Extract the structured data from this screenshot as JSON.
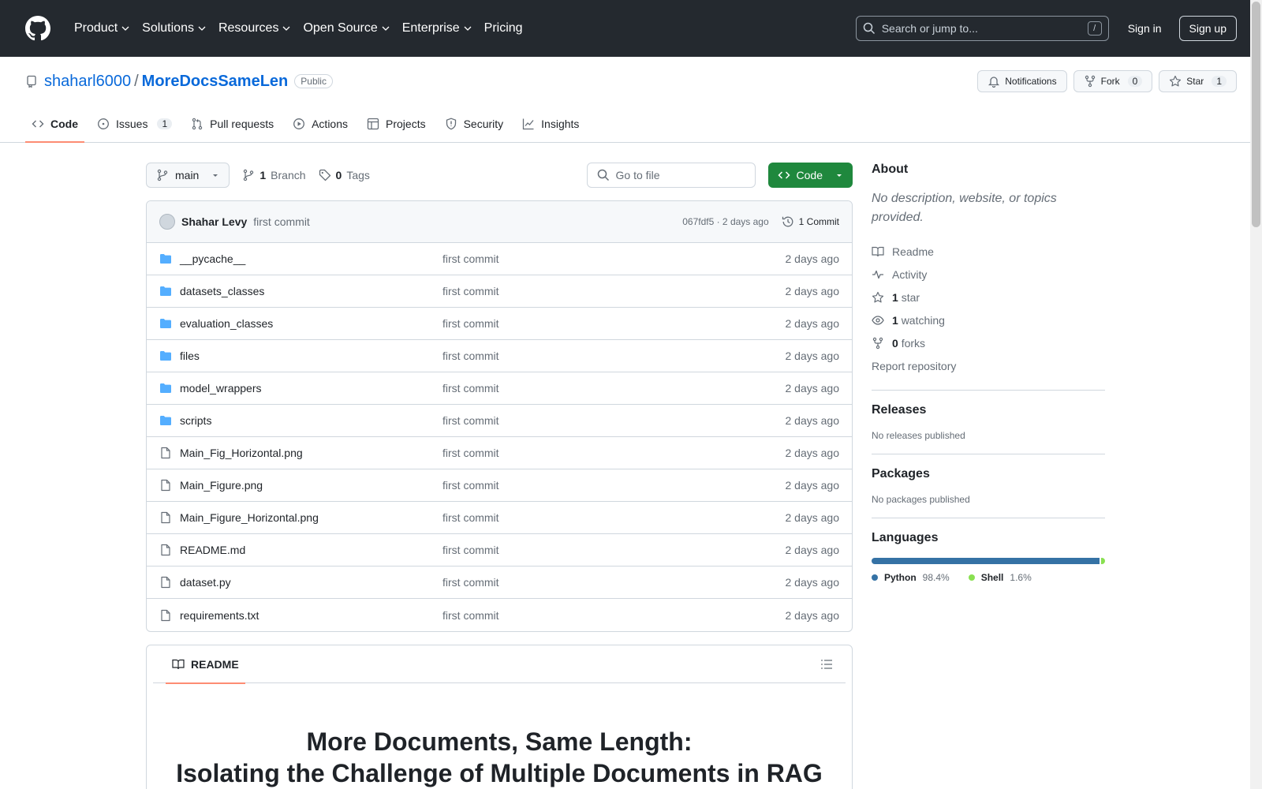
{
  "header": {
    "nav": [
      "Product",
      "Solutions",
      "Resources",
      "Open Source",
      "Enterprise",
      "Pricing"
    ],
    "search_placeholder": "Search or jump to...",
    "search_kbd": "/",
    "signin": "Sign in",
    "signup": "Sign up"
  },
  "repo": {
    "owner": "shaharl6000",
    "name": "MoreDocsSameLen",
    "visibility": "Public",
    "notifications_label": "Notifications",
    "fork_label": "Fork",
    "fork_count": "0",
    "star_label": "Star",
    "star_count": "1"
  },
  "tabs": [
    {
      "label": "Code"
    },
    {
      "label": "Issues",
      "count": "1"
    },
    {
      "label": "Pull requests"
    },
    {
      "label": "Actions"
    },
    {
      "label": "Projects"
    },
    {
      "label": "Security"
    },
    {
      "label": "Insights"
    }
  ],
  "toolbar": {
    "branch": "main",
    "branch_count": "1",
    "branch_label": "Branch",
    "tag_count": "0",
    "tag_label": "Tags",
    "gofile_placeholder": "Go to file",
    "code_button": "Code"
  },
  "commit": {
    "author": "Shahar Levy",
    "message": "first commit",
    "hash_time": "067fdf5 · 2 days ago",
    "count_label": "1 Commit"
  },
  "files": [
    {
      "name": "__pycache__",
      "type": "dir",
      "message": "first commit",
      "date": "2 days ago"
    },
    {
      "name": "datasets_classes",
      "type": "dir",
      "message": "first commit",
      "date": "2 days ago"
    },
    {
      "name": "evaluation_classes",
      "type": "dir",
      "message": "first commit",
      "date": "2 days ago"
    },
    {
      "name": "files",
      "type": "dir",
      "message": "first commit",
      "date": "2 days ago"
    },
    {
      "name": "model_wrappers",
      "type": "dir",
      "message": "first commit",
      "date": "2 days ago"
    },
    {
      "name": "scripts",
      "type": "dir",
      "message": "first commit",
      "date": "2 days ago"
    },
    {
      "name": "Main_Fig_Horizontal.png",
      "type": "file",
      "message": "first commit",
      "date": "2 days ago"
    },
    {
      "name": "Main_Figure.png",
      "type": "file",
      "message": "first commit",
      "date": "2 days ago"
    },
    {
      "name": "Main_Figure_Horizontal.png",
      "type": "file",
      "message": "first commit",
      "date": "2 days ago"
    },
    {
      "name": "README.md",
      "type": "file",
      "message": "first commit",
      "date": "2 days ago"
    },
    {
      "name": "dataset.py",
      "type": "file",
      "message": "first commit",
      "date": "2 days ago"
    },
    {
      "name": "requirements.txt",
      "type": "file",
      "message": "first commit",
      "date": "2 days ago"
    }
  ],
  "readme": {
    "tab_label": "README",
    "title_line1": "More Documents, Same Length:",
    "title_line2": "Isolating the Challenge of Multiple Documents in RAG"
  },
  "sidebar": {
    "about_title": "About",
    "description": "No description, website, or topics provided.",
    "links": [
      {
        "icon": "book-icon",
        "bold": "",
        "label": "Readme"
      },
      {
        "icon": "pulse-icon",
        "bold": "",
        "label": "Activity"
      },
      {
        "icon": "star-icon",
        "bold": "1",
        "label": "star"
      },
      {
        "icon": "eye-icon",
        "bold": "1",
        "label": "watching"
      },
      {
        "icon": "fork-icon",
        "bold": "0",
        "label": "forks"
      }
    ],
    "report": "Report repository",
    "releases_title": "Releases",
    "releases_text": "No releases published",
    "packages_title": "Packages",
    "packages_text": "No packages published",
    "languages_title": "Languages",
    "languages": [
      {
        "name": "Python",
        "percent": "98.4%",
        "value": 98.4,
        "color": "#3572A5"
      },
      {
        "name": "Shell",
        "percent": "1.6%",
        "value": 1.6,
        "color": "#89e051"
      }
    ]
  }
}
